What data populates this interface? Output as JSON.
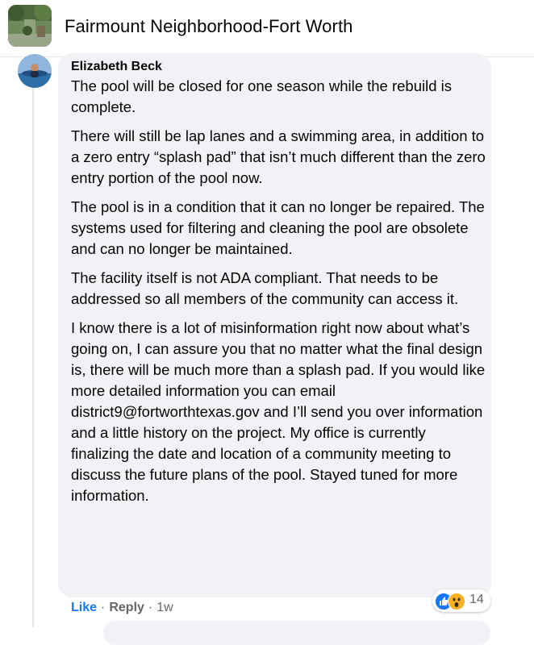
{
  "header": {
    "group_name": "Fairmount Neighborhood-Fort Worth"
  },
  "comment": {
    "author": "Elizabeth Beck",
    "paragraphs": [
      "The pool will be closed for one season while the rebuild is complete.",
      "There will still be lap lanes and a swimming area, in addition to a zero entry “splash pad” that isn’t much different than the zero entry portion of the pool now.",
      "The pool is in a condition that it can no longer be repaired. The systems used for filtering and cleaning the pool are obsolete and can no longer be maintained.",
      "The facility itself is not ADA compliant. That needs to be addressed so all members of the community can access it.",
      "I know there is a lot of misinformation right now about what’s going on, I can assure you that no matter what the final design is, there will be much more than a splash pad. If you would like more detailed information you can email district9@fortworthtexas.gov and I’ll send you over information and a little history on the project. My office is currently finalizing the date and location of a community meeting to discuss the future plans of the pool. Stayed tuned for more information."
    ],
    "actions": {
      "like": "Like",
      "reply": "Reply",
      "time": "1w",
      "separator": "·"
    },
    "reactions": {
      "count": "14",
      "types": [
        "like-icon",
        "wow-icon"
      ]
    }
  },
  "colors": {
    "accent": "#1877f2",
    "bubble": "#f0f2f5",
    "muted": "#65676b"
  }
}
